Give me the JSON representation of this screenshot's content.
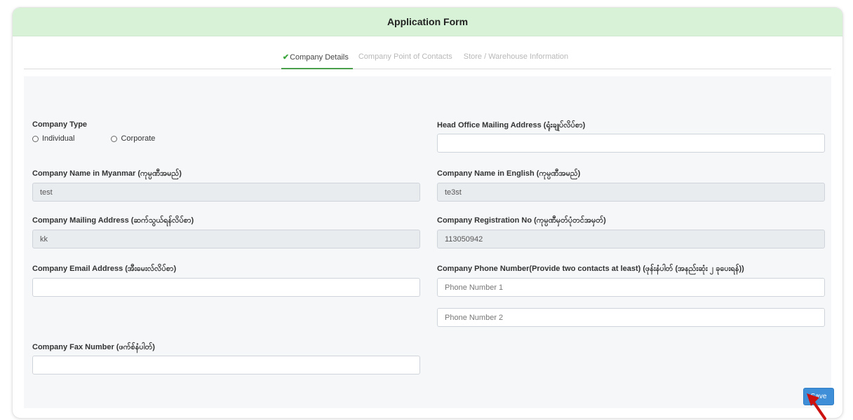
{
  "header": {
    "title": "Application Form"
  },
  "tabs": [
    {
      "label": "Company Details",
      "active": true
    },
    {
      "label": "Company Point of Contacts",
      "active": false
    },
    {
      "label": "Store / Warehouse Information",
      "active": false
    }
  ],
  "form": {
    "company_type": {
      "label": "Company Type",
      "options": [
        "Individual",
        "Corporate"
      ]
    },
    "head_office_address": {
      "label": "Head Office Mailing Address (ရုံးချုပ်လိပ်စာ)",
      "value": ""
    },
    "name_myanmar": {
      "label": "Company Name in Myanmar (ကုမ္ပဏီအမည်)",
      "value": "test"
    },
    "name_english": {
      "label": "Company Name in English (ကုမ္ပဏီအမည်)",
      "value": "te3st"
    },
    "mailing_address": {
      "label": "Company Mailing Address (ဆက်သွယ်ရန်လိပ်စာ)",
      "value": "kk"
    },
    "registration_no": {
      "label": "Company Registration No (ကုမ္ပဏီမှတ်ပုံတင်အမှတ်)",
      "value": "113050942"
    },
    "email": {
      "label": "Company Email Address (အီးမေးလ်လိပ်စာ)",
      "value": ""
    },
    "phone": {
      "label": "Company Phone Number(Provide two contacts at least) (ဖုန်းနံပါတ် (အနည်းဆုံး ၂ ခုပေးရန်))",
      "placeholder1": "Phone Number 1",
      "placeholder2": "Phone Number 2"
    },
    "fax": {
      "label": "Company Fax Number (ဖက်စ်နံပါတ်)",
      "value": ""
    },
    "save_label": "Save"
  },
  "colors": {
    "header_bg": "#d7f2d7",
    "active_tab_underline": "#4aa04a",
    "save_button": "#3f8fd8",
    "cursor": "#cc1111"
  }
}
